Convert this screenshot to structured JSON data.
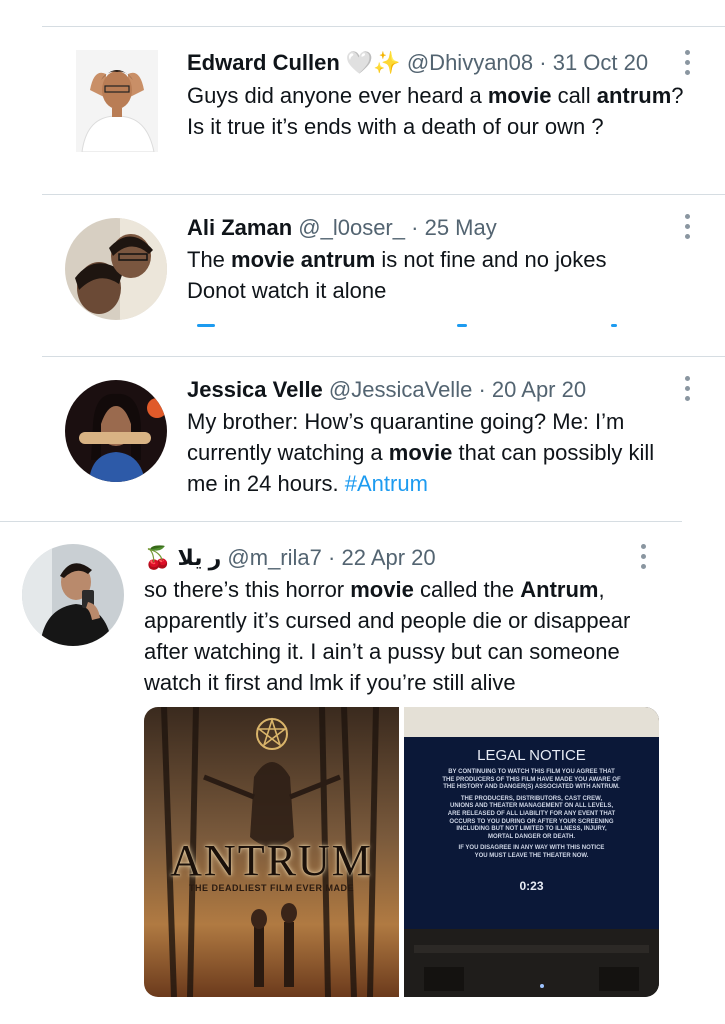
{
  "colors": {
    "accent": "#1d9bf0",
    "muted": "#536471",
    "divider": "#d6dde2"
  },
  "tweets": [
    {
      "name": "Edward Cullen",
      "name_emoji": "🤍✨",
      "handle": "@Dhivyan08",
      "sep": "·",
      "date": "31 Oct 20",
      "text": [
        {
          "t": "Guys did anyone ever heard a "
        },
        {
          "t": "movie",
          "b": true
        },
        {
          "t": " call "
        },
        {
          "t": "antrum",
          "b": true
        },
        {
          "t": "? Is it true it’s ends with a death of our own ?"
        }
      ],
      "avatar_icon": "profile-photo"
    },
    {
      "name": "Ali Zaman",
      "handle": "@_l0oser_",
      "sep": "·",
      "date": "25 May",
      "text": [
        {
          "t": "The "
        },
        {
          "t": "movie antrum",
          "b": true
        },
        {
          "t": " is not fine and no jokes Donot watch it alone"
        }
      ],
      "avatar_icon": "profile-photo"
    },
    {
      "name": "Jessica Velle",
      "handle": "@JessicaVelle",
      "sep": "·",
      "date": "20 Apr 20",
      "text": [
        {
          "t": "My brother: How’s quarantine going? Me: I’m currently watching a "
        },
        {
          "t": "movie",
          "b": true
        },
        {
          "t": " that can possibly kill me in 24 hours. "
        },
        {
          "t": "#Antrum",
          "h": true
        }
      ],
      "avatar_icon": "profile-photo"
    },
    {
      "name": "ر يلا",
      "name_emoji": "🍒",
      "handle": "@m_rila7",
      "sep": "·",
      "date": "22 Apr 20",
      "text": [
        {
          "t": "so there’s this horror "
        },
        {
          "t": "movie",
          "b": true
        },
        {
          "t": " called the "
        },
        {
          "t": "Antrum",
          "b": true
        },
        {
          "t": ", apparently it’s cursed and people die or disappear after watching it. I ain’t a pussy but can someone watch it first and lmk if you’re still alive"
        }
      ],
      "avatar_icon": "profile-photo",
      "media": {
        "poster": {
          "title": "ANTRUM",
          "tagline": "THE DEADLIEST FILM EVER MADE",
          "icon": "pentagram-icon"
        },
        "notice": {
          "heading": "LEGAL NOTICE",
          "lines": [
            "BY CONTINUING TO WATCH THIS FILM YOU AGREE THAT",
            "THE PRODUCERS OF THIS FILM HAVE MADE YOU AWARE OF",
            "THE HISTORY AND DANGER(S) ASSOCIATED WITH ANTRUM.",
            "",
            "THE PRODUCERS, DISTRIBUTORS, CAST CREW,",
            "UNIONS AND THEATER MANAGEMENT ON ALL LEVELS,",
            "ARE RELEASED OF ALL LIABILITY FOR ANY EVENT THAT",
            "OCCURS TO YOU DURING OR AFTER YOUR SCREENING",
            "INCLUDING BUT NOT LIMITED TO ILLNESS, INJURY,",
            "MORTAL DANGER OR DEATH.",
            "",
            "IF YOU DISAGREE IN ANY WAY WITH THIS NOTICE",
            "YOU MUST LEAVE THE THEATER NOW."
          ],
          "timer": "0:23"
        }
      }
    }
  ]
}
